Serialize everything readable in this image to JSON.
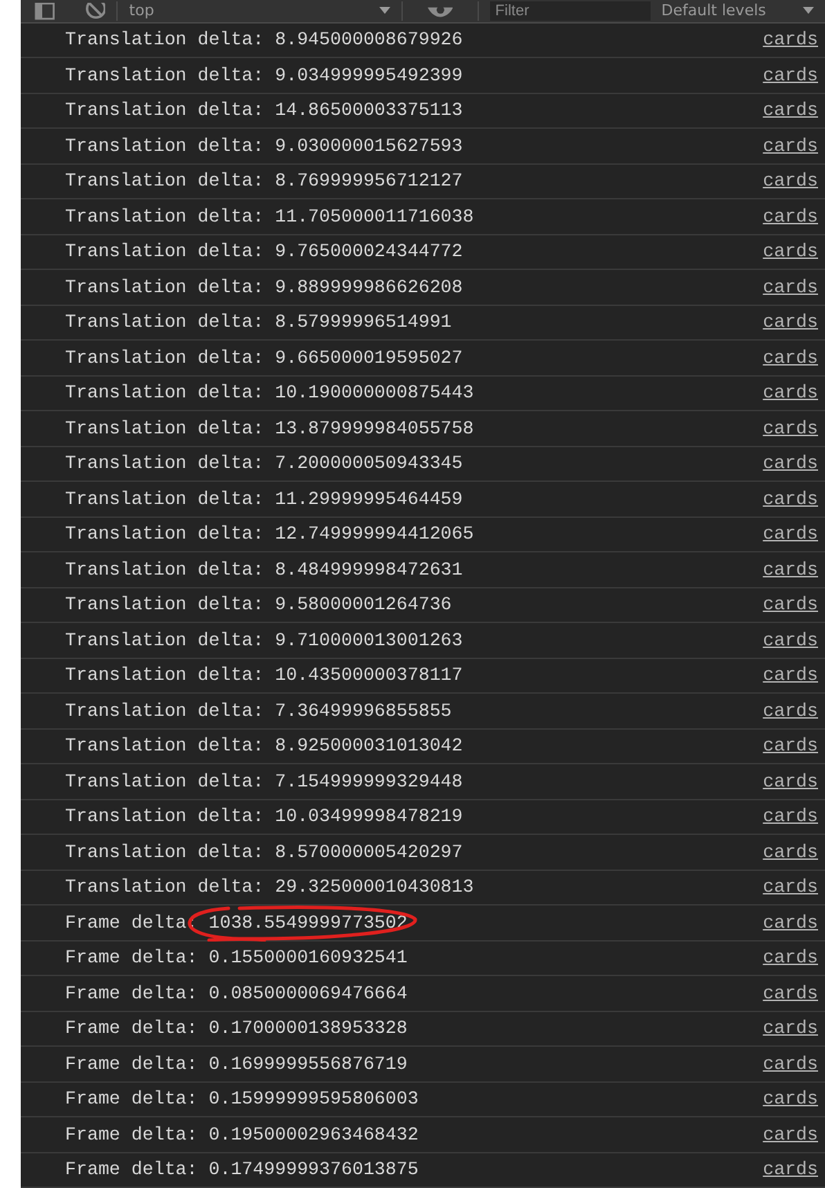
{
  "toolbar": {
    "context": "top",
    "filter": {
      "placeholder": "Filter"
    },
    "levels": "Default levels"
  },
  "messages": [
    {
      "text": "Translation delta: 8.945000008679926",
      "source": "cards",
      "highlighted": false
    },
    {
      "text": "Translation delta: 9.034999995492399",
      "source": "cards",
      "highlighted": false
    },
    {
      "text": "Translation delta: 14.86500003375113",
      "source": "cards",
      "highlighted": false
    },
    {
      "text": "Translation delta: 9.030000015627593",
      "source": "cards",
      "highlighted": false
    },
    {
      "text": "Translation delta: 8.769999956712127",
      "source": "cards",
      "highlighted": false
    },
    {
      "text": "Translation delta: 11.705000011716038",
      "source": "cards",
      "highlighted": false
    },
    {
      "text": "Translation delta: 9.765000024344772",
      "source": "cards",
      "highlighted": false
    },
    {
      "text": "Translation delta: 9.889999986626208",
      "source": "cards",
      "highlighted": false
    },
    {
      "text": "Translation delta: 8.57999996514991",
      "source": "cards",
      "highlighted": false
    },
    {
      "text": "Translation delta: 9.665000019595027",
      "source": "cards",
      "highlighted": false
    },
    {
      "text": "Translation delta: 10.190000000875443",
      "source": "cards",
      "highlighted": false
    },
    {
      "text": "Translation delta: 13.879999984055758",
      "source": "cards",
      "highlighted": false
    },
    {
      "text": "Translation delta: 7.200000050943345",
      "source": "cards",
      "highlighted": false
    },
    {
      "text": "Translation delta: 11.29999995464459",
      "source": "cards",
      "highlighted": false
    },
    {
      "text": "Translation delta: 12.749999994412065",
      "source": "cards",
      "highlighted": false
    },
    {
      "text": "Translation delta: 8.484999998472631",
      "source": "cards",
      "highlighted": false
    },
    {
      "text": "Translation delta: 9.58000001264736",
      "source": "cards",
      "highlighted": false
    },
    {
      "text": "Translation delta: 9.710000013001263",
      "source": "cards",
      "highlighted": false
    },
    {
      "text": "Translation delta: 10.43500000378117",
      "source": "cards",
      "highlighted": false
    },
    {
      "text": "Translation delta: 7.36499996855855",
      "source": "cards",
      "highlighted": false
    },
    {
      "text": "Translation delta: 8.925000031013042",
      "source": "cards",
      "highlighted": false
    },
    {
      "text": "Translation delta: 7.154999999329448",
      "source": "cards",
      "highlighted": false
    },
    {
      "text": "Translation delta: 10.03499998478219",
      "source": "cards",
      "highlighted": false
    },
    {
      "text": "Translation delta: 8.570000005420297",
      "source": "cards",
      "highlighted": false
    },
    {
      "text": "Translation delta: 29.325000010430813",
      "source": "cards",
      "highlighted": false
    },
    {
      "text": "Frame delta: 1038.5549999773502",
      "source": "cards",
      "highlighted": true
    },
    {
      "text": "Frame delta: 0.1550000160932541",
      "source": "cards",
      "highlighted": false
    },
    {
      "text": "Frame delta: 0.0850000069476664",
      "source": "cards",
      "highlighted": false
    },
    {
      "text": "Frame delta: 0.1700000138953328",
      "source": "cards",
      "highlighted": false
    },
    {
      "text": "Frame delta: 0.1699999556876719",
      "source": "cards",
      "highlighted": false
    },
    {
      "text": "Frame delta: 0.15999999595806003",
      "source": "cards",
      "highlighted": false
    },
    {
      "text": "Frame delta: 0.19500002963468432",
      "source": "cards",
      "highlighted": false
    },
    {
      "text": "Frame delta: 0.17499999376013875",
      "source": "cards",
      "highlighted": false
    }
  ]
}
